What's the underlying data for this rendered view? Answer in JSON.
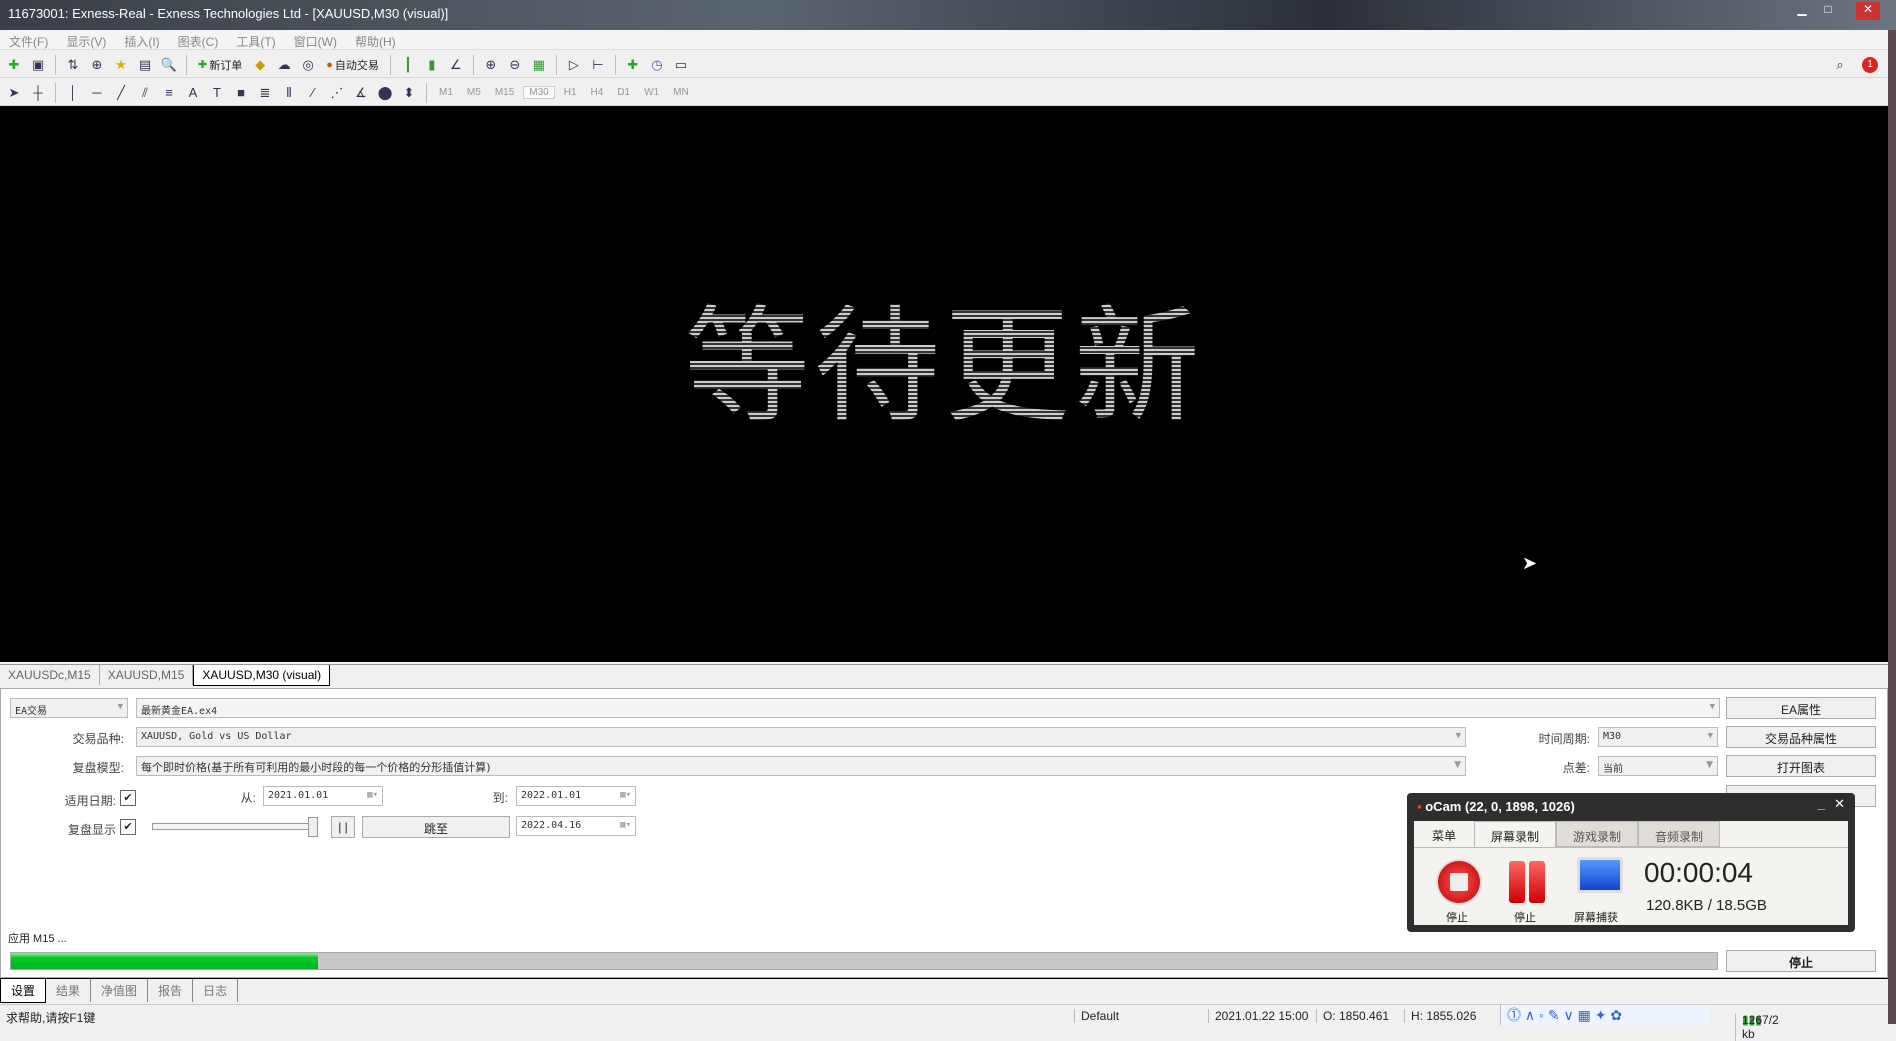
{
  "window": {
    "title": "11673001: Exness-Real - Exness Technologies Ltd - [XAUUSD,M30 (visual)]"
  },
  "menu": [
    "文件(F)",
    "显示(V)",
    "插入(I)",
    "图表(C)",
    "工具(T)",
    "窗口(W)",
    "帮助(H)"
  ],
  "toolbar": {
    "new_order": "新订单",
    "auto_trade": "自动交易"
  },
  "timeframes": [
    "M1",
    "M5",
    "M15",
    "M30",
    "H1",
    "H4",
    "D1",
    "W1",
    "MN"
  ],
  "active_timeframe": "M30",
  "chart": {
    "message": "等待更新"
  },
  "chart_tabs": [
    "XAUUSDc,M15",
    "XAUUSD,M15",
    "XAUUSD,M30 (visual)"
  ],
  "tester": {
    "mode": "EA交易",
    "expert": "最新黄金EA.ex4",
    "symbol_label": "交易品种:",
    "symbol": "XAUUSD, Gold vs US Dollar",
    "model_label": "复盘模型:",
    "model": "每个即时价格(基于所有可利用的最小时段的每一个价格的分形插值计算)",
    "period_label": "时间周期:",
    "period": "M30",
    "spread_label": "点差:",
    "spread": "当前",
    "use_date_label": "适用日期:",
    "from_label": "从:",
    "from": "2021.01.01",
    "to_label": "到:",
    "to": "2022.01.01",
    "visual_label": "复盘显示",
    "pause": "| |",
    "jump": "跳至",
    "jump_date": "2022.04.16",
    "buttons": {
      "expert_props": "EA属性",
      "symbol_props": "交易品种属性",
      "open_chart": "打开图表",
      "stop": "停止"
    },
    "status_text": "应用 M15 ...",
    "progress_percent": 18
  },
  "bottom_tabs": [
    "设置",
    "结果",
    "净值图",
    "报告",
    "日志"
  ],
  "statusbar": {
    "help": "求帮助,请按F1键",
    "profile": "Default",
    "datetime": "2021.01.22 15:00",
    "open": "O: 1850.461",
    "high": "H: 1855.026",
    "traffic": "1267/2 kb"
  },
  "ocam": {
    "title": "oCam (22, 0, 1898, 1026)",
    "tabs": [
      "菜单",
      "屏幕录制",
      "游戏录制",
      "音频录制"
    ],
    "stop": "停止",
    "pause": "停止",
    "capture": "屏幕捕获",
    "time": "00:00:04",
    "size": "120.8KB / 18.5GB"
  }
}
